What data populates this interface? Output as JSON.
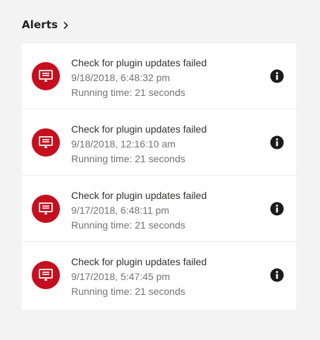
{
  "header": {
    "title": "Alerts",
    "chevron_icon": "chevron-right-icon"
  },
  "alerts": [
    {
      "title": "Check for plugin updates failed",
      "timestamp": "9/18/2018, 6:48:32 pm",
      "running_time": "Running time: 21 seconds"
    },
    {
      "title": "Check for plugin updates failed",
      "timestamp": "9/18/2018, 12:16:10 am",
      "running_time": "Running time: 21 seconds"
    },
    {
      "title": "Check for plugin updates failed",
      "timestamp": "9/17/2018, 6:48:11 pm",
      "running_time": "Running time: 21 seconds"
    },
    {
      "title": "Check for plugin updates failed",
      "timestamp": "9/17/2018, 5:47:45 pm",
      "running_time": "Running time: 21 seconds"
    }
  ],
  "icons": {
    "alert": "monitor-alert-icon",
    "info": "info-icon"
  },
  "colors": {
    "alert_icon_bg": "#c50f1f",
    "background": "#f3f3f3",
    "card": "#ffffff"
  }
}
